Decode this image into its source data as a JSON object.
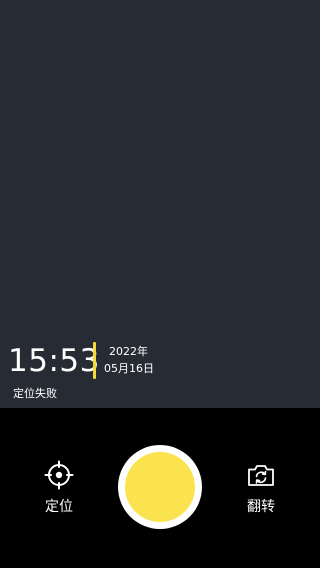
{
  "watermark": {
    "time": "15:53",
    "year": "2022年",
    "date": "05月16日",
    "location_status": "定位失败",
    "accent_color": "#f4d93a"
  },
  "controls": {
    "locate": {
      "label": "定位",
      "icon": "crosshair-locate-icon"
    },
    "shutter": {
      "icon": "shutter-button",
      "color": "#fbe34f"
    },
    "flip": {
      "label": "翻转",
      "icon": "camera-flip-icon"
    }
  },
  "colors": {
    "viewfinder_bg": "#272c34",
    "bottom_bar_bg": "#000000"
  }
}
